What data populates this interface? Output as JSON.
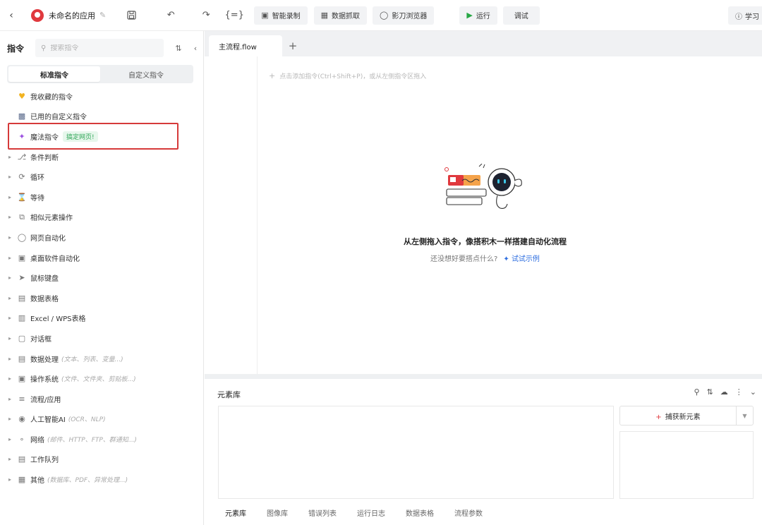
{
  "toolbar": {
    "app_name": "未命名的应用",
    "buttons": [
      {
        "label": "智能录制",
        "icon": "video-icon"
      },
      {
        "label": "数据抓取",
        "icon": "table-icon"
      },
      {
        "label": "影刀浏览器",
        "icon": "browser-icon"
      },
      {
        "label": "运行",
        "icon": "play-icon"
      },
      {
        "label": "调试",
        "icon": ""
      }
    ],
    "help_label": "学习"
  },
  "left": {
    "title": "指令",
    "search_placeholder": "搜索指令",
    "segments": [
      "标准指令",
      "自定义指令"
    ],
    "active_segment": 0,
    "top_items": [
      {
        "label": "我收藏的指令",
        "icon": "heart-icon"
      },
      {
        "label": "已用的自定义指令",
        "icon": "package-icon"
      },
      {
        "label": "魔法指令",
        "icon": "sparkle-icon",
        "tag": "搞定网页!"
      }
    ],
    "groups": [
      {
        "label": "条件判断",
        "icon": "branch-icon",
        "sub": ""
      },
      {
        "label": "循环",
        "icon": "loop-icon",
        "sub": ""
      },
      {
        "label": "等待",
        "icon": "hourglass-icon",
        "sub": ""
      },
      {
        "label": "相似元素操作",
        "icon": "copy-icon",
        "sub": ""
      },
      {
        "label": "网页自动化",
        "icon": "globe-icon",
        "sub": ""
      },
      {
        "label": "桌面软件自动化",
        "icon": "monitor-icon",
        "sub": ""
      },
      {
        "label": "鼠标键盘",
        "icon": "cursor-icon",
        "sub": ""
      },
      {
        "label": "数据表格",
        "icon": "sheet-icon",
        "sub": ""
      },
      {
        "label": "Excel / WPS表格",
        "icon": "excel-icon",
        "sub": ""
      },
      {
        "label": "对话框",
        "icon": "dialog-icon",
        "sub": ""
      },
      {
        "label": "数据处理",
        "icon": "data-icon",
        "sub": "(文本、列表、变量...)"
      },
      {
        "label": "操作系统",
        "icon": "system-icon",
        "sub": "(文件、文件夹、剪贴板...)"
      },
      {
        "label": "流程/应用",
        "icon": "layers-icon",
        "sub": ""
      },
      {
        "label": "人工智能AI",
        "icon": "ai-icon",
        "sub": "(OCR、NLP)"
      },
      {
        "label": "网络",
        "icon": "network-icon",
        "sub": "(邮件、HTTP、FTP、群通知...)"
      },
      {
        "label": "工作队列",
        "icon": "queue-icon",
        "sub": ""
      },
      {
        "label": "其他",
        "icon": "grid-icon",
        "sub": "(数据库、PDF、异常处理...)"
      }
    ]
  },
  "tabs": {
    "active": "主流程.flow"
  },
  "canvas": {
    "hint": "点击添加指令(Ctrl+Shift+P)，或从左侧指令区拖入",
    "empty_title": "从左侧拖入指令，像搭积木一样搭建自动化流程",
    "empty_sub": "还没想好要搭点什么?",
    "empty_link": "试试示例"
  },
  "element_lib": {
    "title": "元素库",
    "capture_label": "捕获新元素",
    "bottom_tabs": [
      "元素库",
      "图像库",
      "错误列表",
      "运行日志",
      "数据表格",
      "流程参数"
    ],
    "active_bottom_tab": 0
  },
  "colors": {
    "accent_red": "#e0393e",
    "highlight_border": "#d63a3a",
    "link_blue": "#2f6fe0",
    "tag_green": "#2ea556"
  }
}
